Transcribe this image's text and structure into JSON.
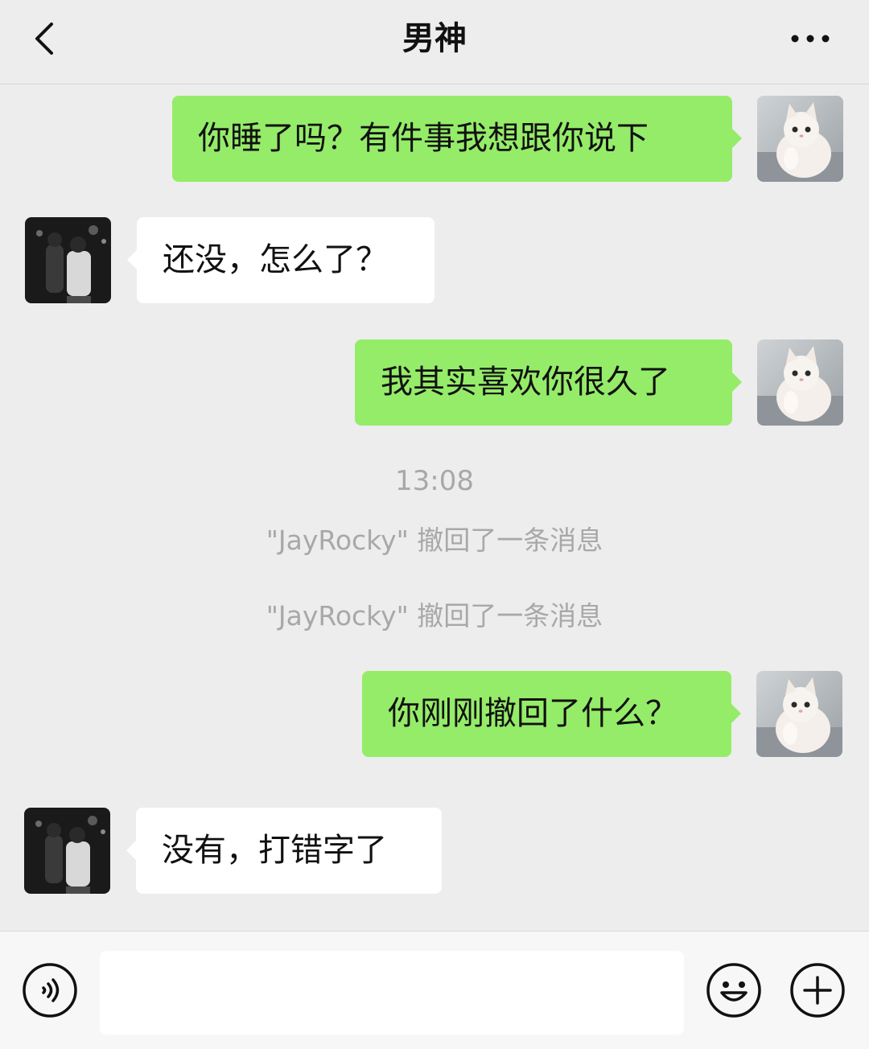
{
  "header": {
    "title": "男神",
    "back_icon": "chevron-left-icon",
    "more_icon": "more-dots-icon"
  },
  "messages": [
    {
      "side": "out",
      "text": "你睡了吗？有件事我想跟你说下"
    },
    {
      "side": "in",
      "text": "还没，怎么了？"
    },
    {
      "side": "out",
      "text": "我其实喜欢你很久了"
    },
    {
      "side": "out",
      "text": "你刚刚撤回了什么？"
    },
    {
      "side": "in",
      "text": "没有，打错字了"
    }
  ],
  "system": {
    "timestamp": "13:08",
    "recalled": [
      "\"JayRocky\" 撤回了一条消息",
      "\"JayRocky\" 撤回了一条消息"
    ]
  },
  "bottom_bar": {
    "voice_icon": "voice-icon",
    "input_value": "",
    "emoji_icon": "emoji-icon",
    "add_icon": "plus-circle-icon"
  },
  "colors": {
    "outgoing_bubble": "#95ec69",
    "incoming_bubble": "#ffffff",
    "background": "#ededed"
  }
}
